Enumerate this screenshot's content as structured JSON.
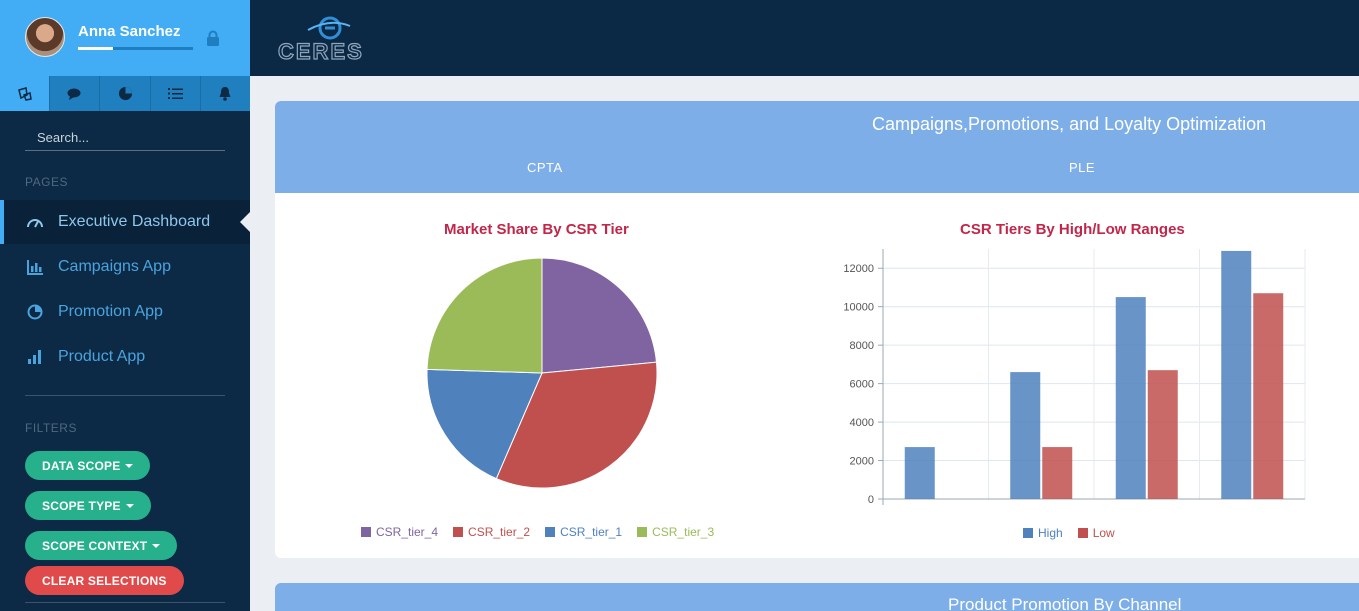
{
  "user": {
    "name": "Anna Sanchez",
    "progress": 0.3
  },
  "sidebar": {
    "search_placeholder": "Search...",
    "pages_label": "PAGES",
    "filters_label": "FILTERS",
    "nav": [
      {
        "label": "Executive Dashboard",
        "icon": "speedometer-icon",
        "active": true
      },
      {
        "label": "Campaigns App",
        "icon": "bar-chart-icon"
      },
      {
        "label": "Promotion App",
        "icon": "pie-chart-icon"
      },
      {
        "label": "Product App",
        "icon": "signal-bars-icon"
      }
    ],
    "filters": {
      "data_scope": "DATA SCOPE",
      "scope_type": "SCOPE TYPE",
      "scope_context": "SCOPE CONTEXT",
      "clear": "CLEAR SELECTIONS"
    },
    "icon_tabs": [
      "dashboard-icon",
      "chat-icon",
      "pie-icon",
      "list-icon",
      "bell-icon"
    ]
  },
  "logo_text": "CERES",
  "panel": {
    "title": "Campaigns,Promotions, and Loyalty Optimization",
    "tabs": [
      "CPTA",
      "PLE"
    ]
  },
  "panel2": {
    "title": "Product Promotion By Channel"
  },
  "colors": {
    "accent": "#42adf5",
    "panel_head": "#7daee8",
    "chart_title": "#c2264a"
  },
  "chart_data": [
    {
      "type": "pie",
      "title": "Market Share By CSR Tier",
      "series": [
        {
          "name": "CSR_tier_4",
          "value": 23.5,
          "color": "#8064a2"
        },
        {
          "name": "CSR_tier_2",
          "value": 33.0,
          "color": "#c0504d"
        },
        {
          "name": "CSR_tier_1",
          "value": 19.0,
          "color": "#4f81bd"
        },
        {
          "name": "CSR_tier_3",
          "value": 24.5,
          "color": "#9bbb59"
        }
      ]
    },
    {
      "type": "bar",
      "title": "CSR Tiers By High/Low Ranges",
      "categories": [
        "",
        "",
        "",
        ""
      ],
      "series": [
        {
          "name": "High",
          "values": [
            2700,
            6600,
            10500,
            12900
          ],
          "color": "#4f81bd"
        },
        {
          "name": "Low",
          "values": [
            0,
            2700,
            6700,
            10700
          ],
          "color": "#c0504d"
        }
      ],
      "yticks": [
        "0",
        "2000",
        "4000",
        "6000",
        "8000",
        "10000",
        "12000"
      ],
      "ylim": [
        0,
        13000
      ],
      "grid": true,
      "legend": "bottom"
    }
  ]
}
